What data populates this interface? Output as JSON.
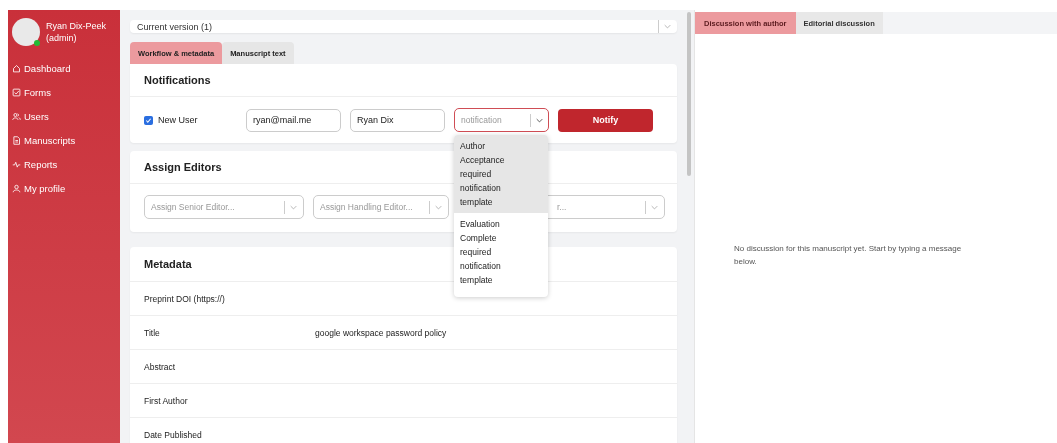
{
  "user": {
    "name": "Ryan Dix-Peek",
    "role": "(admin)",
    "online": true
  },
  "nav": [
    {
      "label": "Dashboard",
      "kind": "home"
    },
    {
      "label": "Forms",
      "kind": "forms"
    },
    {
      "label": "Users",
      "kind": "users"
    },
    {
      "label": "Manuscripts",
      "kind": "manuscripts"
    },
    {
      "label": "Reports",
      "kind": "reports"
    },
    {
      "label": "My profile",
      "kind": "profile"
    }
  ],
  "version_select": {
    "value": "Current version (1)"
  },
  "tabs": [
    {
      "label": "Workflow & metadata",
      "selected": true
    },
    {
      "label": "Manuscript text",
      "selected": false
    }
  ],
  "notifications": {
    "title": "Notifications",
    "checkbox": {
      "label": "New User",
      "checked": true
    },
    "email": "ryan@mail.me",
    "name": "Ryan Dix",
    "template_select": {
      "placeholder": "notification"
    },
    "button": "Notify",
    "options": [
      {
        "label": "Author Acceptance required notification template",
        "selected": true
      },
      {
        "label": "Evaluation Complete required notification template",
        "selected": false
      }
    ]
  },
  "assign_editors": {
    "title": "Assign Editors",
    "selects": [
      {
        "placeholder": "Assign Senior Editor..."
      },
      {
        "placeholder": "Assign Handling Editor..."
      },
      {
        "placeholder": "r..."
      }
    ]
  },
  "metadata": {
    "title": "Metadata",
    "rows": [
      {
        "label": "Preprint DOI (https://)",
        "value": ""
      },
      {
        "label": "Title",
        "value": "google workspace password policy"
      },
      {
        "label": "Abstract",
        "value": ""
      },
      {
        "label": "First Author",
        "value": ""
      },
      {
        "label": "Date Published",
        "value": ""
      }
    ]
  },
  "discussion": {
    "tabs": [
      {
        "label": "Discussion with author",
        "selected": true
      },
      {
        "label": "Editorial discussion",
        "selected": false
      }
    ],
    "empty_message": "No discussion for this manuscript yet. Start by typing a message below."
  }
}
